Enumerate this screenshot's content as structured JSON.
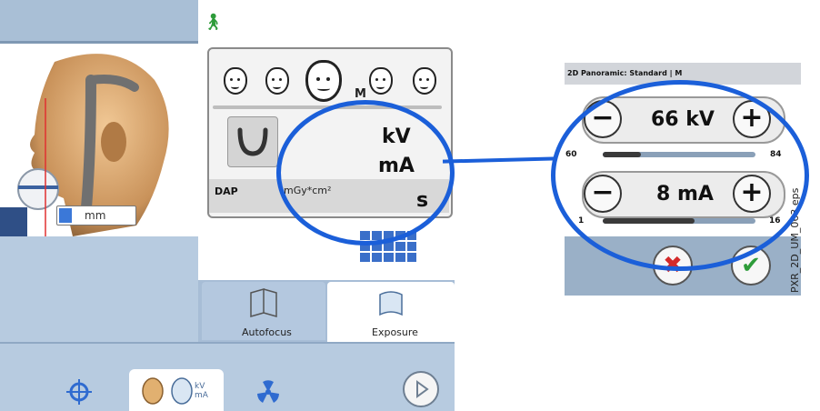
{
  "left_view": {
    "measure_unit": "mm"
  },
  "exposure_panel": {
    "patient_sizes": [
      "face-xs",
      "face-s",
      "face-m",
      "face-l",
      "face-xl"
    ],
    "selected_size_label": "M",
    "kv_label": "kV",
    "ma_label": "mA",
    "dap_label": "DAP",
    "dap_unit": "mGy*cm²",
    "time_label": "s"
  },
  "tabs": {
    "autofocus": "Autofocus",
    "exposure": "Exposure"
  },
  "bottom_nav": {
    "kv_ma_icon_text": "kV\nmA"
  },
  "detail": {
    "title": "2D Panoramic: Standard | M",
    "kv": {
      "value": "66 kV",
      "min": "60",
      "max": "84",
      "level": 0.25
    },
    "ma": {
      "value": "8 mA",
      "min": "1",
      "max": "16",
      "level": 0.6
    },
    "minus": "−",
    "plus": "+",
    "cancel": "✖",
    "confirm": "✔"
  },
  "figure_ref": "PXR_2D_UM_063.eps",
  "colors": {
    "callout": "#1b5fd9",
    "panel_blue": "#b7cbe0",
    "confirm_green": "#2e9c3a",
    "cancel_red": "#d42a2a"
  }
}
